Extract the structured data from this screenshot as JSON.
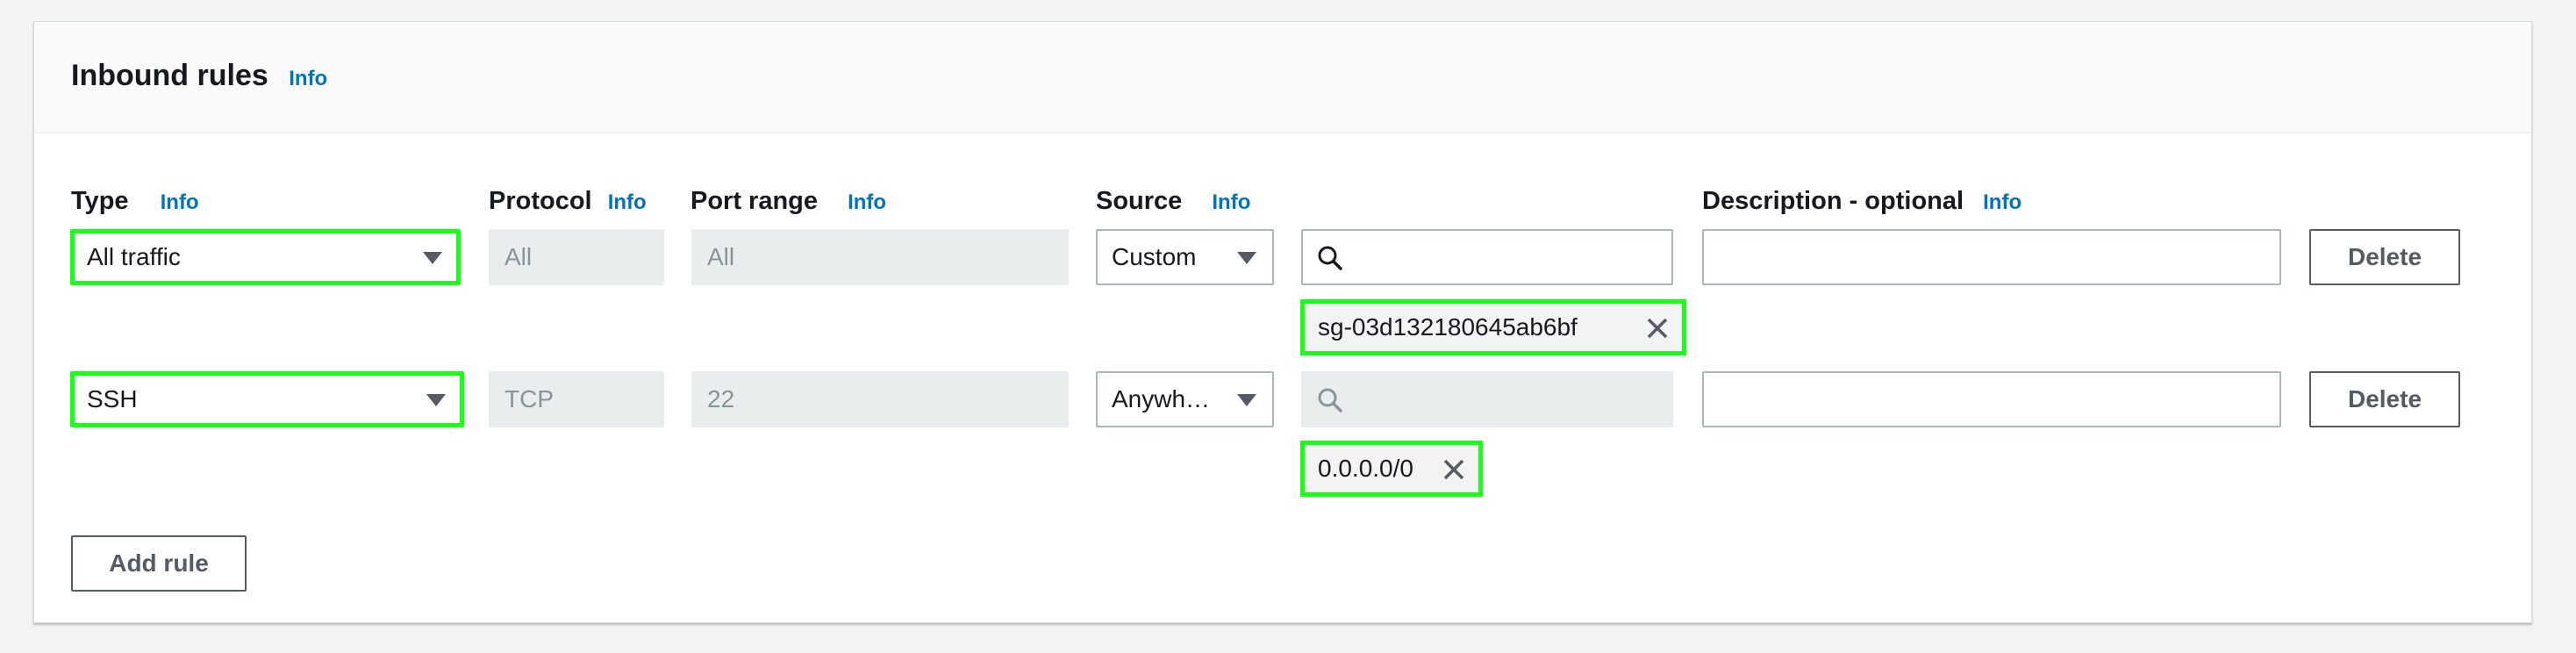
{
  "panel": {
    "title": "Inbound rules",
    "title_info": "Info",
    "add_rule_label": "Add rule"
  },
  "columns": {
    "type": "Type",
    "protocol": "Protocol",
    "port_range": "Port range",
    "source": "Source",
    "description": "Description - optional",
    "info": "Info"
  },
  "rules": [
    {
      "type": "All traffic",
      "protocol": "All",
      "port_range": "All",
      "source_type": "Custom",
      "search_value": "",
      "token": "sg-03d132180645ab6bf",
      "description": "",
      "delete_label": "Delete"
    },
    {
      "type": "SSH",
      "protocol": "TCP",
      "port_range": "22",
      "source_type": "Anywh…",
      "search_value": "",
      "token": "0.0.0.0/0",
      "description": "",
      "delete_label": "Delete"
    }
  ],
  "colors": {
    "link": "#0073bb",
    "highlight": "#1aff1a",
    "disabled_bg": "#eaeded",
    "button_border": "#545b64"
  }
}
